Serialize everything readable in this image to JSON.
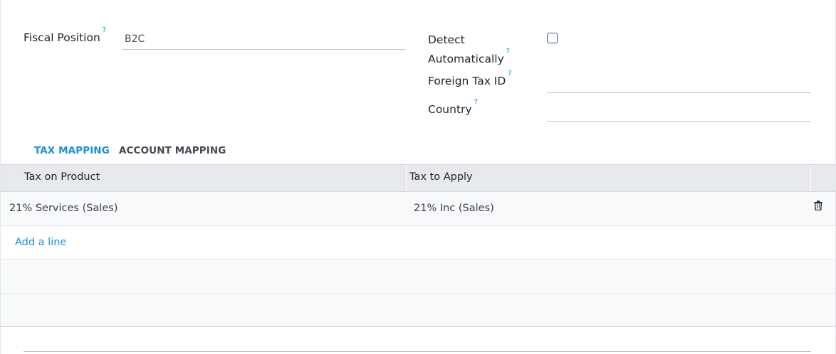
{
  "form": {
    "fiscal_position_label": "Fiscal Position",
    "fiscal_position_help": "?",
    "fiscal_position_value": "B2C",
    "detect_label_line1": "Detect",
    "detect_label_line2": "Automatically",
    "detect_help": "?",
    "detect_checked": false,
    "foreign_tax_label": "Foreign Tax ID",
    "foreign_tax_help": "?",
    "foreign_tax_value": "",
    "country_label": "Country",
    "country_help": "?",
    "country_value": ""
  },
  "tabs": [
    {
      "label": "TAX MAPPING",
      "active": true
    },
    {
      "label": "ACCOUNT MAPPING",
      "active": false
    }
  ],
  "table": {
    "columns": [
      "Tax on Product",
      "Tax to Apply"
    ],
    "rows": [
      {
        "tax_on_product": "21% Services (Sales)",
        "tax_to_apply": "21% Inc (Sales)"
      }
    ],
    "add_line": "Add a line",
    "delete_icon": "trash-icon"
  },
  "colors": {
    "accent": "#1a8fdb",
    "help": "#0d8fd6",
    "checkbox_border": "#2f55b7",
    "header_bg": "#e7e9ed",
    "row_bg": "#f8f9fa"
  }
}
